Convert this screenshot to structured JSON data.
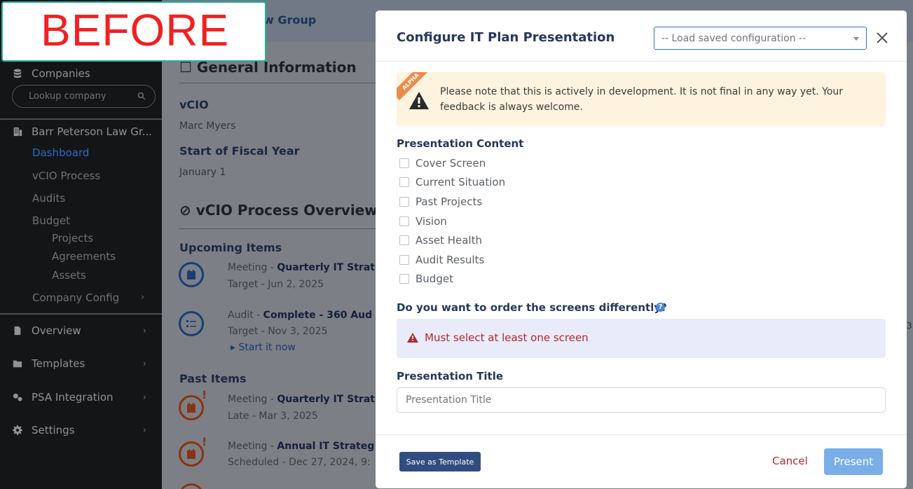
{
  "banner": {
    "text": "BEFORE"
  },
  "sidebar": {
    "companies_label": "Companies",
    "lookup_placeholder": "Lookup company",
    "company_name": "Barr Peterson Law Gr...",
    "links": [
      "Dashboard",
      "vCIO Process",
      "Audits",
      "Budget"
    ],
    "budget_sub": [
      "Projects",
      "Agreements",
      "Assets"
    ],
    "company_config": "Company Config",
    "sections": [
      "Overview",
      "Templates",
      "PSA Integration",
      "Settings"
    ]
  },
  "page": {
    "group_name": "w Group",
    "general_info": "General Information",
    "vcio_label": "vCIO",
    "vcio_value": "Marc Myers",
    "fiscal_label": "Start of Fiscal Year",
    "fiscal_value": "January 1",
    "overview_title": "vCIO Process Overview",
    "upcoming": "Upcoming Items",
    "item1_type": "Meeting - ",
    "item1_name": "Quarterly IT Strat",
    "item1_date": "Target - Jun 2, 2025",
    "item2_type": "Audit - ",
    "item2_name": "Complete - 360 Aud",
    "item2_date": "Target - Nov 3, 2025",
    "item2_link": "Start it now",
    "past": "Past Items",
    "item3_type": "Meeting - ",
    "item3_name": "Quarterly IT Strat",
    "item3_date": "Late - Mar 3, 2025",
    "item4_type": "Meeting - ",
    "item4_name": "Annual IT Strateg",
    "item4_date": "Scheduled - Dec 27, 2024, 9:",
    "edge_digit": "3"
  },
  "modal": {
    "title": "Configure IT Plan Presentation",
    "load_placeholder": "-- Load saved configuration --",
    "alpha_badge": "ALPHA",
    "alert_text": "Please note that this is actively in development. It is not final in any way yet. Your feedback is always welcome.",
    "content_label": "Presentation Content",
    "screens": [
      "Cover Screen",
      "Current Situation",
      "Past Projects",
      "Vision",
      "Asset Health",
      "Audit Results",
      "Budget"
    ],
    "order_question": "Do you want to order the screens differently?",
    "error": "Must select at least one screen",
    "title_label": "Presentation Title",
    "title_placeholder": "Presentation Title",
    "save_template": "Save as Template",
    "cancel": "Cancel",
    "present": "Present"
  },
  "colors": {
    "accent": "#2d6fd1",
    "danger": "#b1272f",
    "warning_bg": "#fdf3df",
    "error_bg": "#e9ebf8"
  }
}
